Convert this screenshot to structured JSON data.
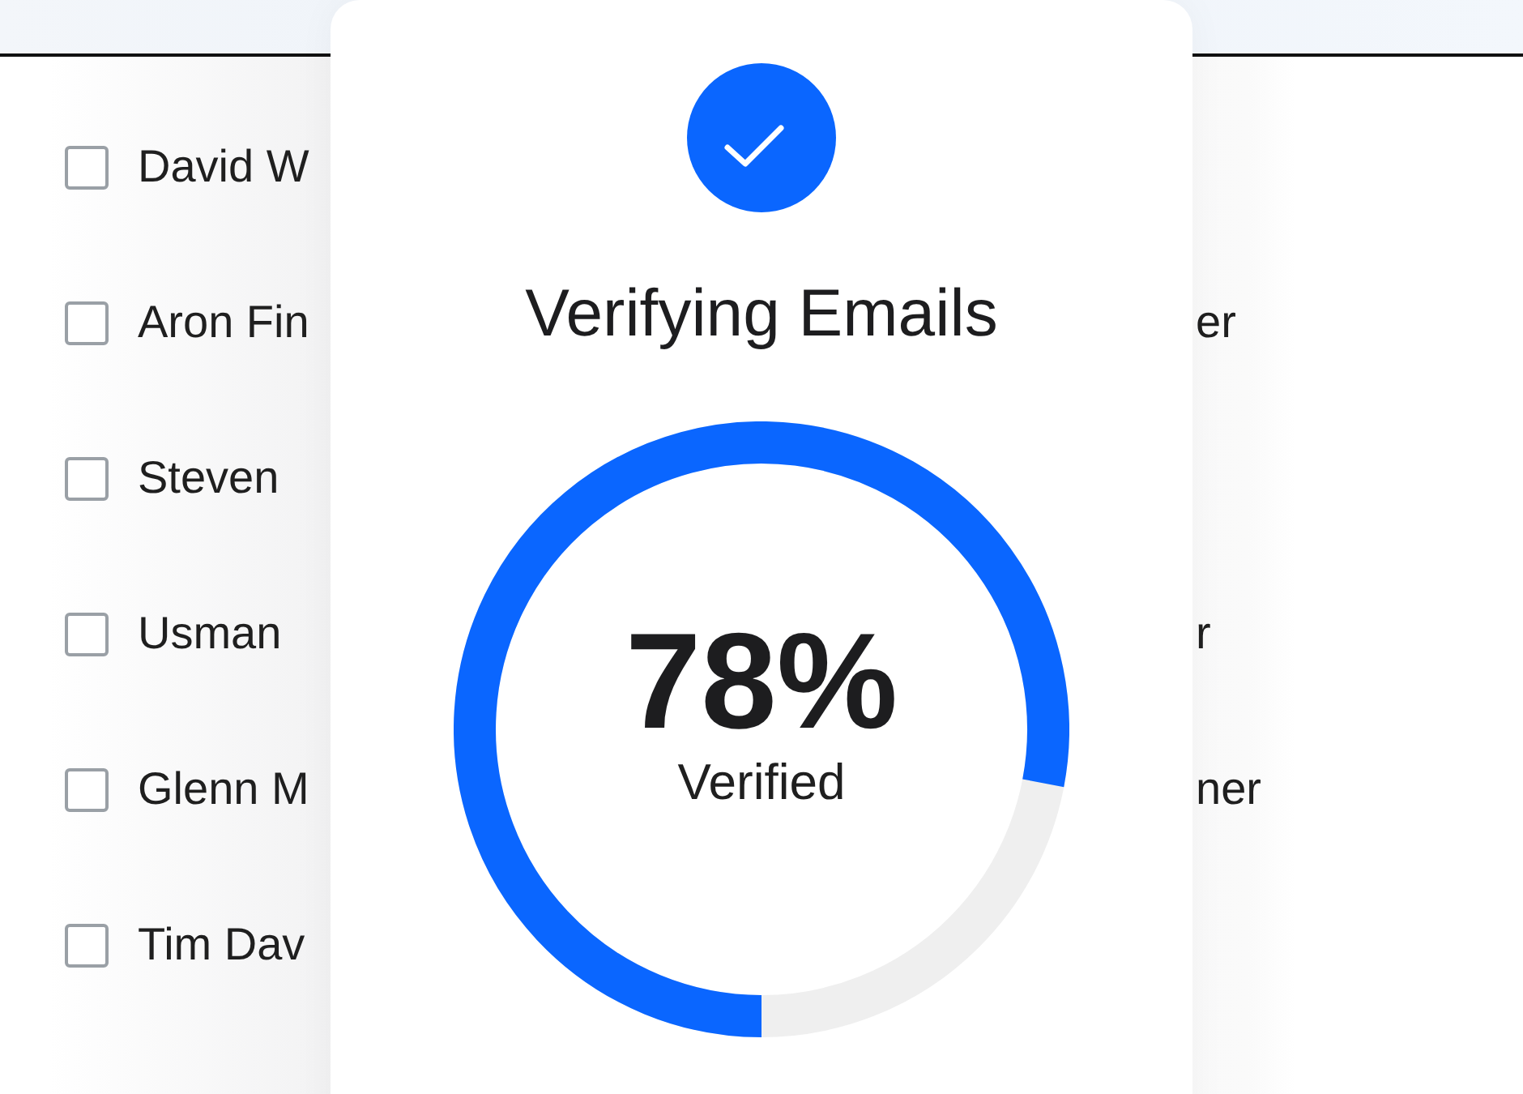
{
  "contacts": [
    {
      "name": "David W",
      "checked": false
    },
    {
      "name": "Aron Fin",
      "detail": "er",
      "checked": false
    },
    {
      "name": "Steven",
      "checked": false
    },
    {
      "name": "Usman",
      "detail": "r",
      "checked": false
    },
    {
      "name": "Glenn M",
      "detail": "ner",
      "checked": false
    },
    {
      "name": "Tim Dav",
      "checked": false
    }
  ],
  "modal": {
    "title": "Verifying Emails",
    "progress": {
      "value": "78%",
      "caption": "Verified"
    }
  }
}
